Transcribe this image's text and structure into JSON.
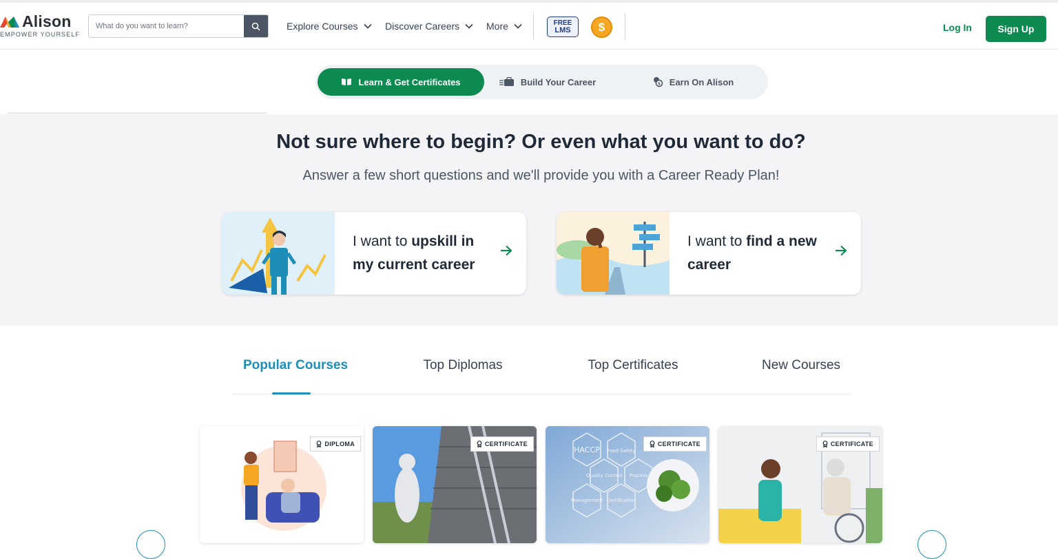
{
  "brand": {
    "name": "Alison",
    "tagline": "EMPOWER YOURSELF"
  },
  "search": {
    "placeholder": "What do you want to learn?"
  },
  "nav": {
    "explore_courses": "Explore Courses",
    "discover_careers": "Discover Careers",
    "more": "More",
    "free_lms_line1": "FREE",
    "free_lms_line2": "LMS",
    "coin_symbol": "$",
    "login": "Log In",
    "signup": "Sign Up"
  },
  "segments": [
    {
      "label": "Learn & Get Certificates",
      "active": true
    },
    {
      "label": "Build Your Career",
      "active": false
    },
    {
      "label": "Earn On Alison",
      "active": false
    }
  ],
  "hero": {
    "title": "Not sure where to begin? Or even what you want to do?",
    "subtitle": "Answer a few short questions and we'll provide you with a Career Ready Plan!",
    "cards": [
      {
        "prefix": "I want to ",
        "bold": "upskill in my current career"
      },
      {
        "prefix": "I want to ",
        "bold": "find a new career"
      }
    ]
  },
  "course_tabs": [
    {
      "label": "Popular Courses",
      "active": true
    },
    {
      "label": "Top Diplomas",
      "active": false
    },
    {
      "label": "Top Certificates",
      "active": false
    },
    {
      "label": "New Courses",
      "active": false
    }
  ],
  "courses": [
    {
      "badge": "DIPLOMA"
    },
    {
      "badge": "CERTIFICATE"
    },
    {
      "badge": "CERTIFICATE",
      "image_words": [
        "HACCP",
        "Food Safety",
        "Quality Control",
        "Process",
        "Management",
        "Certification"
      ]
    },
    {
      "badge": "CERTIFICATE"
    }
  ],
  "colors": {
    "brand_green": "#0d8a4f",
    "tab_blue": "#1c8eb8",
    "coin_orange": "#f5a623"
  }
}
